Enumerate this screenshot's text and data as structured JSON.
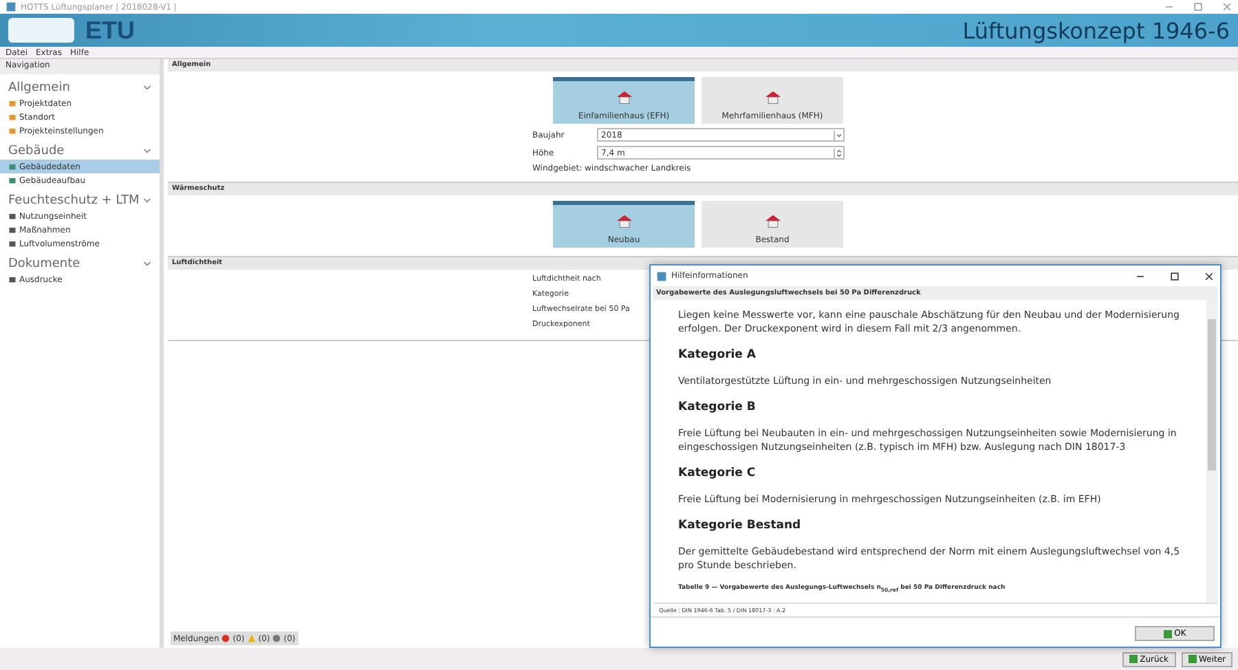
{
  "window": {
    "title": "HOTTS Lüftungsplaner | 2018028-V1 |",
    "app_title": "Lüftungskonzept 1946-6",
    "logo_text": "ETU"
  },
  "menu": [
    "Datei",
    "Extras",
    "Hilfe"
  ],
  "sidebar": {
    "title": "Navigation",
    "groups": [
      {
        "label": "Allgemein",
        "expanded": true,
        "items": [
          {
            "label": "Projektdaten",
            "selected": false
          },
          {
            "label": "Standort",
            "selected": false
          },
          {
            "label": "Projekteinstellungen",
            "selected": false
          }
        ]
      },
      {
        "label": "Gebäude",
        "expanded": true,
        "items": [
          {
            "label": "Gebäudedaten",
            "selected": true
          },
          {
            "label": "Gebäudeaufbau",
            "selected": false
          }
        ]
      },
      {
        "label": "Feuchteschutz + LTM",
        "expanded": true,
        "items": [
          {
            "label": "Nutzungseinheit",
            "selected": false
          },
          {
            "label": "Maßnahmen",
            "selected": false
          },
          {
            "label": "Luftvolumenströme",
            "selected": false
          }
        ]
      },
      {
        "label": "Dokumente",
        "expanded": true,
        "items": [
          {
            "label": "Ausdrucke",
            "selected": false
          }
        ]
      }
    ]
  },
  "sections": [
    {
      "title": "Allgemein",
      "tiles": [
        {
          "label": "Einfamilienhaus (EFH)",
          "selected": true
        },
        {
          "label": "Mehrfamilienhaus (MFH)",
          "selected": false
        }
      ],
      "fields": [
        {
          "label": "Baujahr",
          "value": "2018",
          "kind": "dropdown"
        },
        {
          "label": "Höhe",
          "value": "7,4 m",
          "kind": "spinner"
        }
      ],
      "note": "Windgebiet: windschwacher Landkreis"
    },
    {
      "title": "Wärmeschutz",
      "tiles": [
        {
          "label": "Neubau",
          "selected": true
        },
        {
          "label": "Bestand",
          "selected": false
        }
      ]
    },
    {
      "title": "Luftdichtheit",
      "labels": [
        "Luftdichtheit nach",
        "Kategorie",
        "Luftwechselrate bei 50 Pa",
        "Druckexponent"
      ]
    }
  ],
  "status_bar": {
    "label": "Meldungen",
    "counts": [
      {
        "kind": "error",
        "text": "(0)"
      },
      {
        "kind": "warning",
        "text": "(0)"
      },
      {
        "kind": "info",
        "text": "(0)"
      }
    ]
  },
  "nav_buttons": [
    "Zurück",
    "Weiter"
  ],
  "dialog": {
    "title": "Hilfeinformationen",
    "heading": "Vorgabewerte des Auslegungsluftwechsels bei 50 Pa Differenzdruck",
    "blocks": [
      {
        "kind": "text",
        "text": "Liegen keine Messwerte vor, kann eine pauschale Abschätzung für den Neubau und der Modernisierung erfolgen. Der Druckexponent wird in diesem Fall mit 2/3 angenommen."
      },
      {
        "kind": "heading",
        "text": "Kategorie A"
      },
      {
        "kind": "text",
        "text": "Ventilatorgestützte Lüftung in ein- und mehrgeschossigen Nutzungseinheiten"
      },
      {
        "kind": "heading",
        "text": "Kategorie B"
      },
      {
        "kind": "text",
        "text": "Freie Lüftung bei Neubauten in ein- und mehrgeschossigen Nutzungseinheiten sowie Modernisierung in eingeschossigen Nutzungseinheiten (z.B. typisch im MFH) bzw. Auslegung nach DIN 18017-3"
      },
      {
        "kind": "heading",
        "text": "Kategorie C"
      },
      {
        "kind": "text",
        "text": "Freie Lüftung bei Modernisierung in mehrgeschossigen Nutzungseinheiten (z.B. im EFH)"
      },
      {
        "kind": "heading",
        "text": "Kategorie Bestand"
      },
      {
        "kind": "text",
        "text": "Der gemittelte Gebäudebestand wird entsprechend der Norm mit einem Auslegungsluftwechsel von 4,5 pro Stunde beschrieben."
      },
      {
        "kind": "table_caption",
        "text": "Tabelle 9 — Vorgabewerte des Auslegungs-Luftwechsels n$_{50,ref}$ bei 50 Pa Differenzdruck nach"
      }
    ],
    "source": "Quelle : DIN 1946-6 Tab. 5 / DIN 18017-3 : A.2",
    "ok": "OK"
  }
}
